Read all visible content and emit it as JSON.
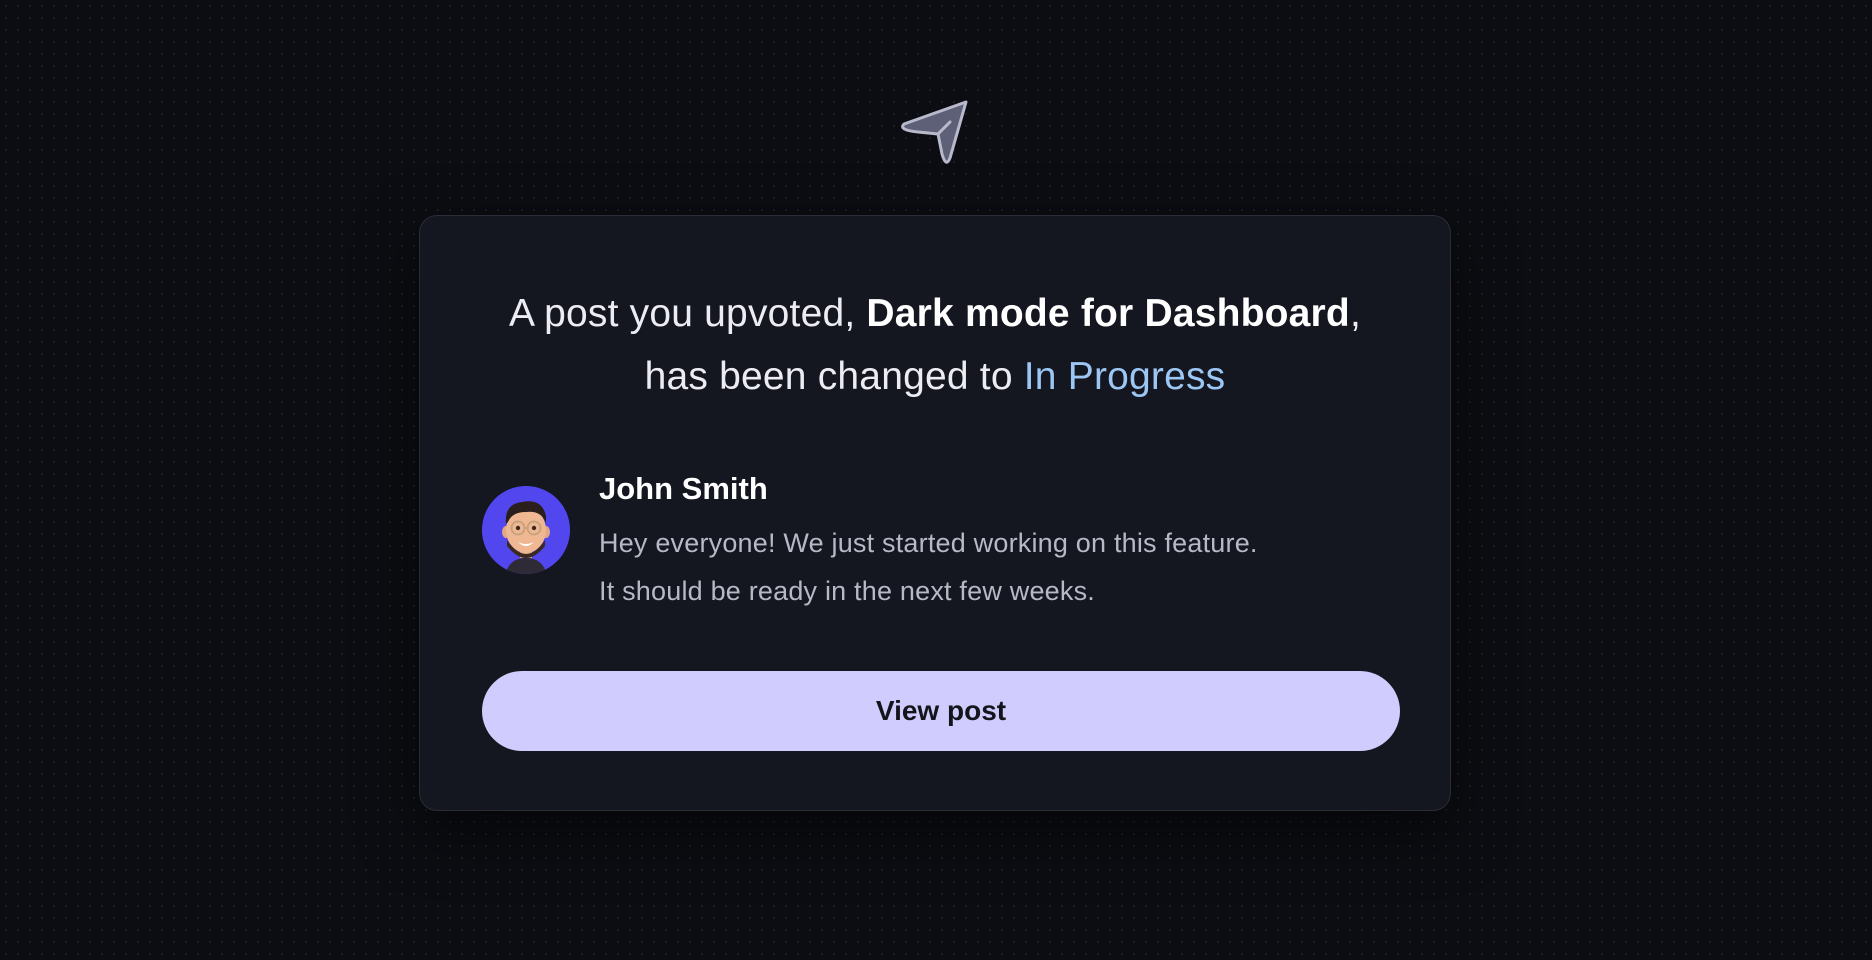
{
  "logo_icon": "paper-plane-icon",
  "notification": {
    "headline_prefix": "A post you upvoted, ",
    "post_title": "Dark mode for Dashboard",
    "headline_mid": ",",
    "headline_line2": "has been changed to ",
    "status": "In Progress",
    "status_color": "#9cc6f4"
  },
  "comment": {
    "avatar_icon": "memoji-avatar-icon",
    "avatar_color": "#5247ee",
    "author": "John Smith",
    "lines": [
      "Hey everyone! We just started working on this feature.",
      "It should be ready in the next few weeks."
    ]
  },
  "button": {
    "label": "View post",
    "color": "#d0ccfd"
  }
}
